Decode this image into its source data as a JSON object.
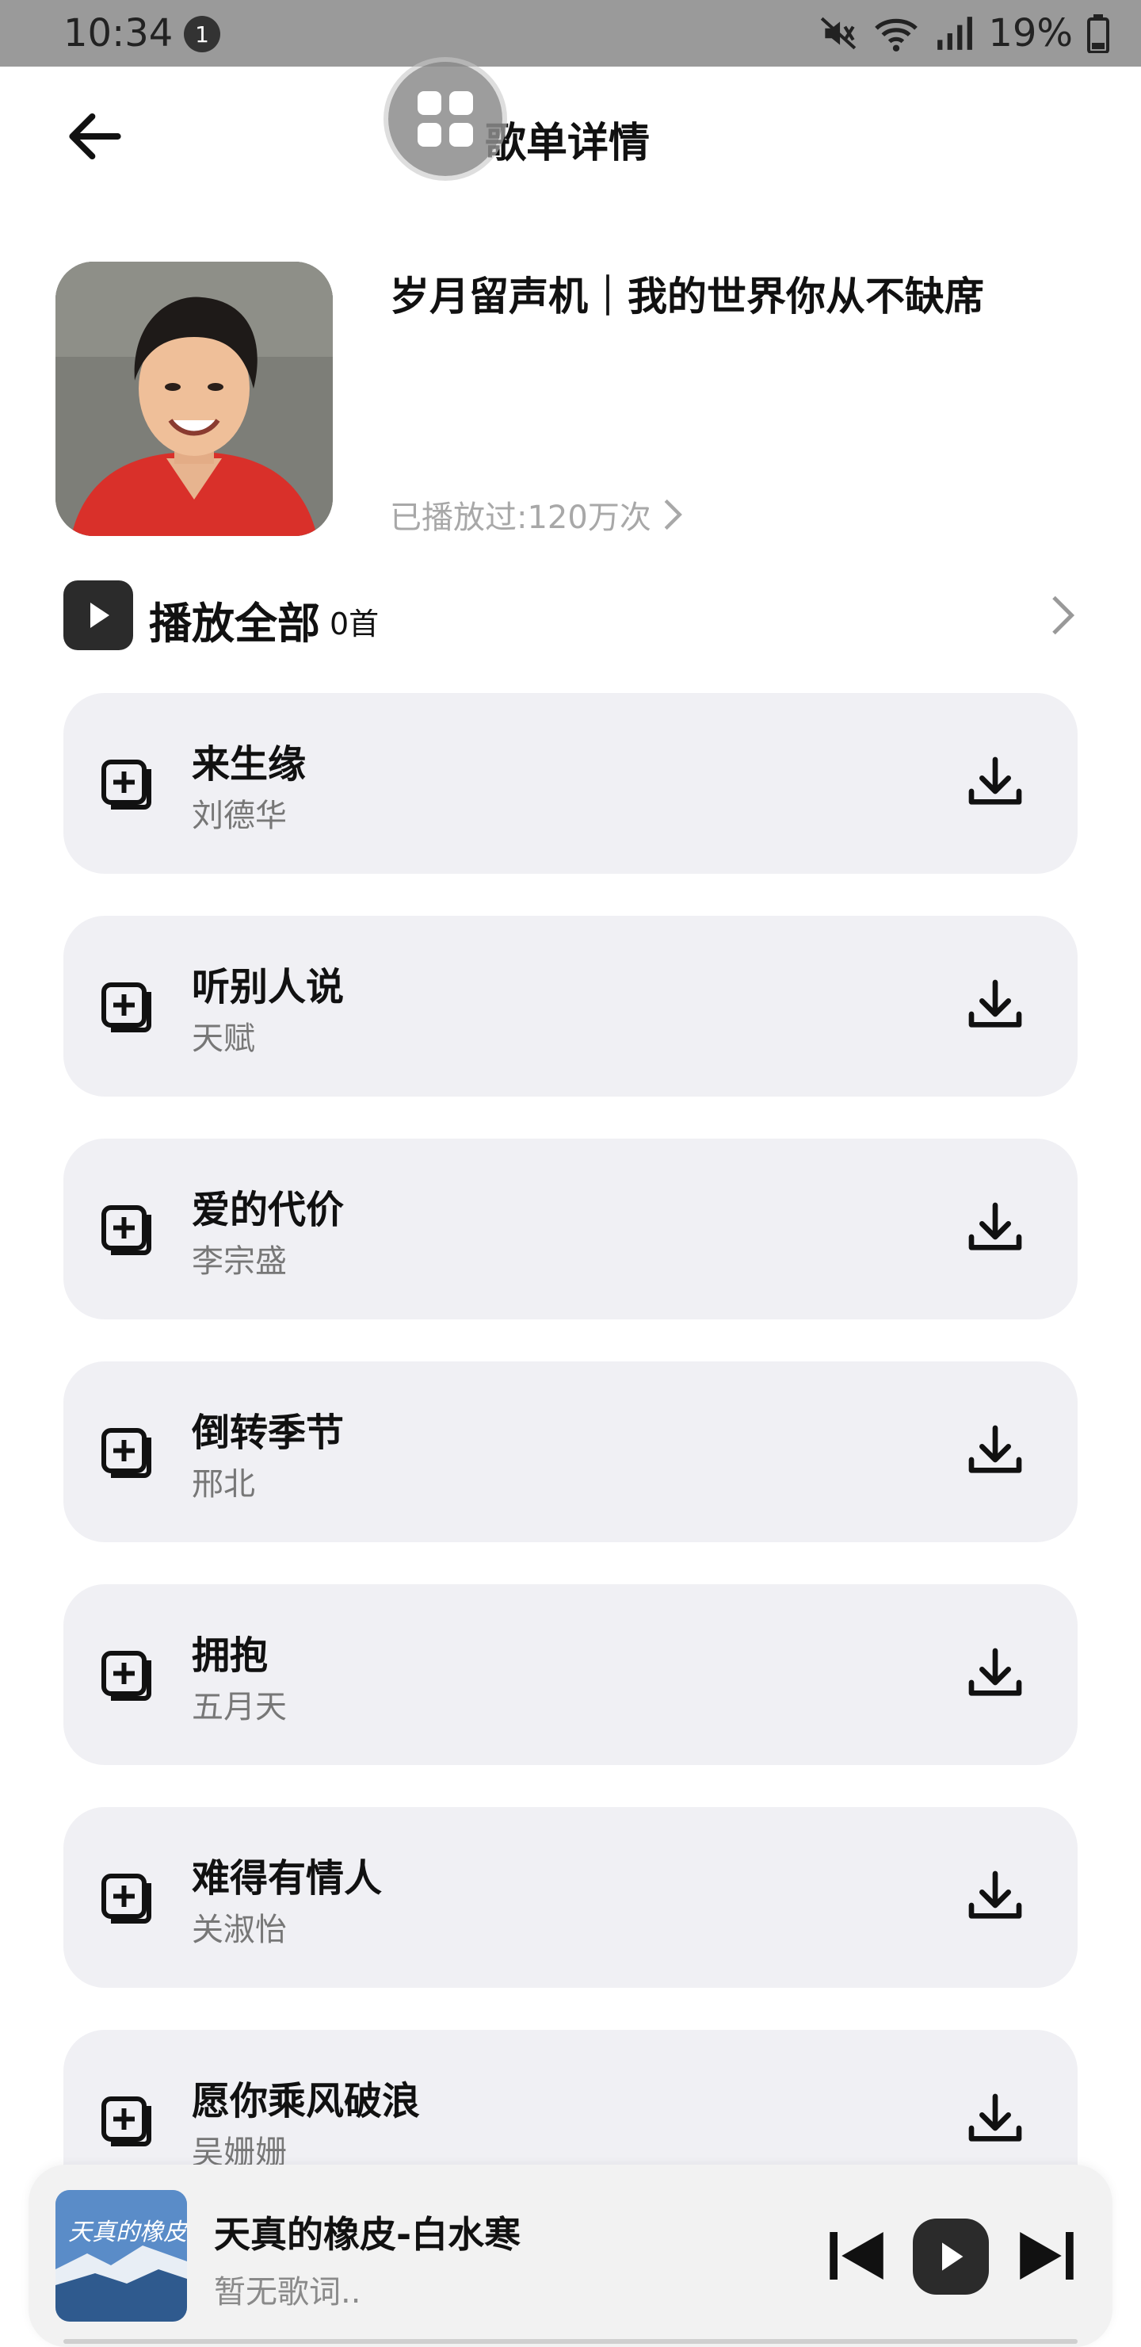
{
  "status_bar": {
    "time": "10:34",
    "notification_count": "1",
    "battery": "19%",
    "icons": [
      "mute-icon",
      "wifi-icon",
      "signal-icon",
      "battery-icon"
    ]
  },
  "header": {
    "title": "歌单详情"
  },
  "playlist": {
    "name": "岁月留声机｜我的世界你从不缺席",
    "play_count": "已播放过:120万次"
  },
  "play_all": {
    "label": "播放全部",
    "count": "0首"
  },
  "songs": [
    {
      "title": "来生缘",
      "artist": "刘德华"
    },
    {
      "title": "听别人说",
      "artist": "天赋"
    },
    {
      "title": "爱的代价",
      "artist": "李宗盛"
    },
    {
      "title": "倒转季节",
      "artist": "邢北"
    },
    {
      "title": "拥抱",
      "artist": "五月天"
    },
    {
      "title": "难得有情人",
      "artist": "关淑怡"
    },
    {
      "title": "愿你乘风破浪",
      "artist": "吴姗姗"
    }
  ],
  "mini_player": {
    "title": "天真的橡皮-白水寒",
    "lyric": "暂无歌词..",
    "cover_text": "天真的橡皮"
  },
  "colors": {
    "card_bg": "#f0f0f4",
    "dark_button": "#2b2b2b",
    "secondary_text": "#777777",
    "muted_text": "#a8a8a8"
  }
}
